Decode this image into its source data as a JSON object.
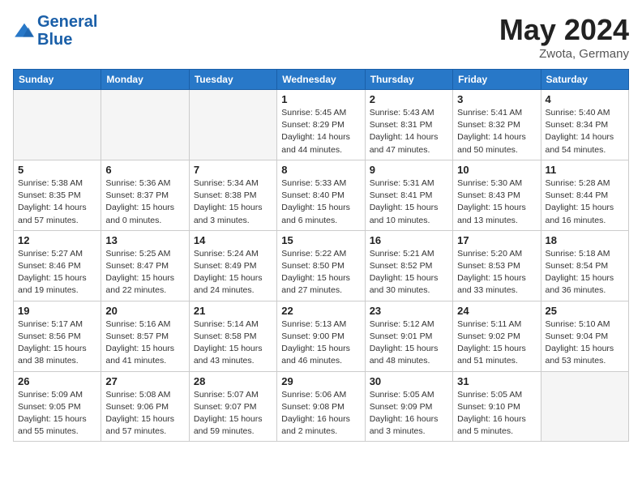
{
  "header": {
    "logo_line1": "General",
    "logo_line2": "Blue",
    "title": "May 2024",
    "location": "Zwota, Germany"
  },
  "days_of_week": [
    "Sunday",
    "Monday",
    "Tuesday",
    "Wednesday",
    "Thursday",
    "Friday",
    "Saturday"
  ],
  "weeks": [
    [
      {
        "day": "",
        "info": ""
      },
      {
        "day": "",
        "info": ""
      },
      {
        "day": "",
        "info": ""
      },
      {
        "day": "1",
        "info": "Sunrise: 5:45 AM\nSunset: 8:29 PM\nDaylight: 14 hours\nand 44 minutes."
      },
      {
        "day": "2",
        "info": "Sunrise: 5:43 AM\nSunset: 8:31 PM\nDaylight: 14 hours\nand 47 minutes."
      },
      {
        "day": "3",
        "info": "Sunrise: 5:41 AM\nSunset: 8:32 PM\nDaylight: 14 hours\nand 50 minutes."
      },
      {
        "day": "4",
        "info": "Sunrise: 5:40 AM\nSunset: 8:34 PM\nDaylight: 14 hours\nand 54 minutes."
      }
    ],
    [
      {
        "day": "5",
        "info": "Sunrise: 5:38 AM\nSunset: 8:35 PM\nDaylight: 14 hours\nand 57 minutes."
      },
      {
        "day": "6",
        "info": "Sunrise: 5:36 AM\nSunset: 8:37 PM\nDaylight: 15 hours\nand 0 minutes."
      },
      {
        "day": "7",
        "info": "Sunrise: 5:34 AM\nSunset: 8:38 PM\nDaylight: 15 hours\nand 3 minutes."
      },
      {
        "day": "8",
        "info": "Sunrise: 5:33 AM\nSunset: 8:40 PM\nDaylight: 15 hours\nand 6 minutes."
      },
      {
        "day": "9",
        "info": "Sunrise: 5:31 AM\nSunset: 8:41 PM\nDaylight: 15 hours\nand 10 minutes."
      },
      {
        "day": "10",
        "info": "Sunrise: 5:30 AM\nSunset: 8:43 PM\nDaylight: 15 hours\nand 13 minutes."
      },
      {
        "day": "11",
        "info": "Sunrise: 5:28 AM\nSunset: 8:44 PM\nDaylight: 15 hours\nand 16 minutes."
      }
    ],
    [
      {
        "day": "12",
        "info": "Sunrise: 5:27 AM\nSunset: 8:46 PM\nDaylight: 15 hours\nand 19 minutes."
      },
      {
        "day": "13",
        "info": "Sunrise: 5:25 AM\nSunset: 8:47 PM\nDaylight: 15 hours\nand 22 minutes."
      },
      {
        "day": "14",
        "info": "Sunrise: 5:24 AM\nSunset: 8:49 PM\nDaylight: 15 hours\nand 24 minutes."
      },
      {
        "day": "15",
        "info": "Sunrise: 5:22 AM\nSunset: 8:50 PM\nDaylight: 15 hours\nand 27 minutes."
      },
      {
        "day": "16",
        "info": "Sunrise: 5:21 AM\nSunset: 8:52 PM\nDaylight: 15 hours\nand 30 minutes."
      },
      {
        "day": "17",
        "info": "Sunrise: 5:20 AM\nSunset: 8:53 PM\nDaylight: 15 hours\nand 33 minutes."
      },
      {
        "day": "18",
        "info": "Sunrise: 5:18 AM\nSunset: 8:54 PM\nDaylight: 15 hours\nand 36 minutes."
      }
    ],
    [
      {
        "day": "19",
        "info": "Sunrise: 5:17 AM\nSunset: 8:56 PM\nDaylight: 15 hours\nand 38 minutes."
      },
      {
        "day": "20",
        "info": "Sunrise: 5:16 AM\nSunset: 8:57 PM\nDaylight: 15 hours\nand 41 minutes."
      },
      {
        "day": "21",
        "info": "Sunrise: 5:14 AM\nSunset: 8:58 PM\nDaylight: 15 hours\nand 43 minutes."
      },
      {
        "day": "22",
        "info": "Sunrise: 5:13 AM\nSunset: 9:00 PM\nDaylight: 15 hours\nand 46 minutes."
      },
      {
        "day": "23",
        "info": "Sunrise: 5:12 AM\nSunset: 9:01 PM\nDaylight: 15 hours\nand 48 minutes."
      },
      {
        "day": "24",
        "info": "Sunrise: 5:11 AM\nSunset: 9:02 PM\nDaylight: 15 hours\nand 51 minutes."
      },
      {
        "day": "25",
        "info": "Sunrise: 5:10 AM\nSunset: 9:04 PM\nDaylight: 15 hours\nand 53 minutes."
      }
    ],
    [
      {
        "day": "26",
        "info": "Sunrise: 5:09 AM\nSunset: 9:05 PM\nDaylight: 15 hours\nand 55 minutes."
      },
      {
        "day": "27",
        "info": "Sunrise: 5:08 AM\nSunset: 9:06 PM\nDaylight: 15 hours\nand 57 minutes."
      },
      {
        "day": "28",
        "info": "Sunrise: 5:07 AM\nSunset: 9:07 PM\nDaylight: 15 hours\nand 59 minutes."
      },
      {
        "day": "29",
        "info": "Sunrise: 5:06 AM\nSunset: 9:08 PM\nDaylight: 16 hours\nand 2 minutes."
      },
      {
        "day": "30",
        "info": "Sunrise: 5:05 AM\nSunset: 9:09 PM\nDaylight: 16 hours\nand 3 minutes."
      },
      {
        "day": "31",
        "info": "Sunrise: 5:05 AM\nSunset: 9:10 PM\nDaylight: 16 hours\nand 5 minutes."
      },
      {
        "day": "",
        "info": ""
      }
    ]
  ]
}
